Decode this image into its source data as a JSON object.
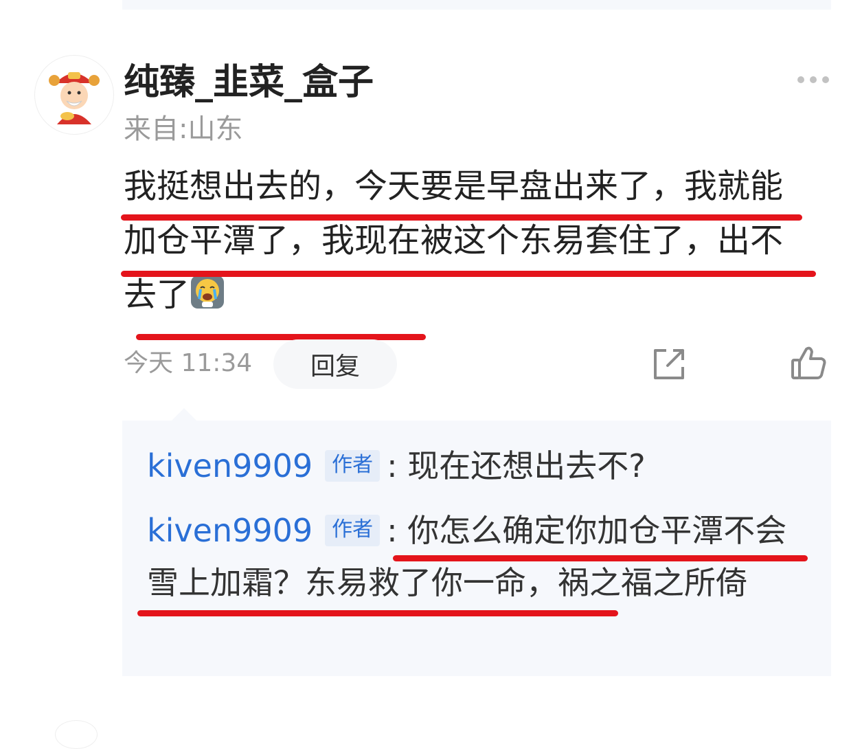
{
  "comment": {
    "username": "纯臻_韭菜_盒子",
    "location": "来自:山东",
    "text": "我挺想出去的，今天要是早盘出来了，我就能加仓平潭了，我现在被这个东易套住了，出不去了",
    "emoji_name": "crying-emoji",
    "timestamp": "今天 11:34",
    "reply_label": "回复"
  },
  "replies": [
    {
      "author": "kiven9909",
      "badge": "作者",
      "separator": ":",
      "text": " 现在还想出去不?"
    },
    {
      "author": "kiven9909",
      "badge": "作者",
      "separator": ":",
      "text": " 你怎么确定你加仓平潭不会雪上加霜？东易救了你一命，祸之福之所倚"
    }
  ],
  "icons": {
    "more": "more-dots-icon",
    "share": "share-icon",
    "like": "thumbs-up-icon"
  },
  "colors": {
    "author_link": "#2a6fd6",
    "highlight_underline": "#e4141b",
    "secondary_text": "#9a9a9a",
    "reply_bg": "#f6f8fc"
  }
}
